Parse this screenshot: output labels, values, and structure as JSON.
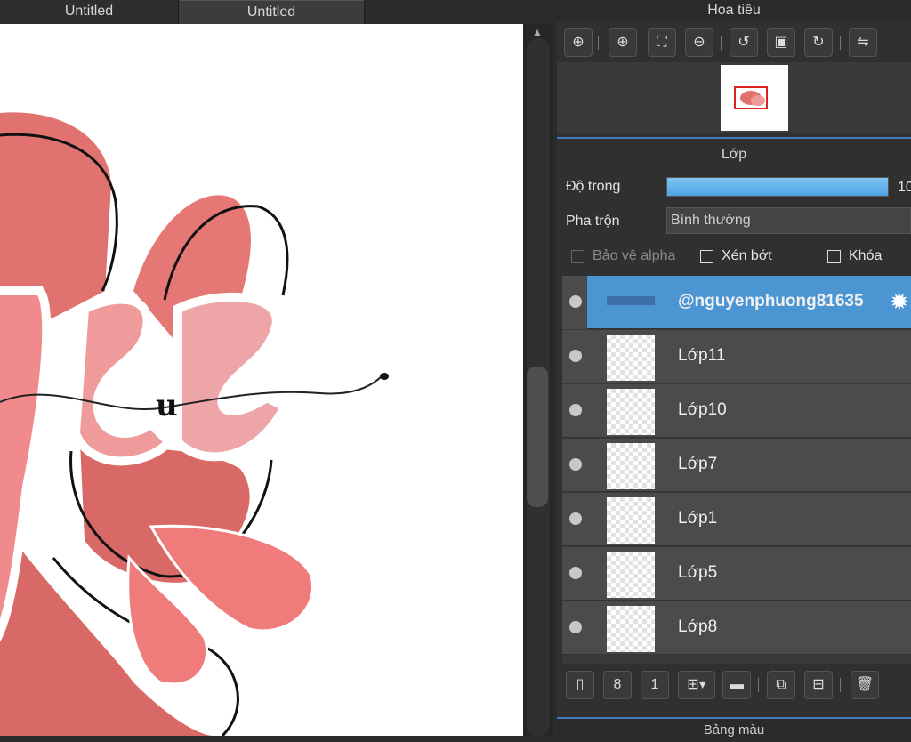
{
  "tabs": [
    "Untitled",
    "Untitled"
  ],
  "navigator": {
    "title": "Hoa tiêu",
    "tools": [
      "zoom-fit-icon",
      "zoom-in-icon",
      "fit-screen-icon",
      "zoom-out-icon",
      "rotate-left-icon",
      "reset-view-icon",
      "rotate-right-icon",
      "flip-icon"
    ]
  },
  "layer_panel": {
    "title": "Lớp",
    "opacity_label": "Độ trong",
    "opacity_value": "10",
    "blend_label": "Pha trộn",
    "blend_value": "Bình thường",
    "protect_alpha": "Bảo vệ alpha",
    "clipping": "Xén bớt",
    "lock": "Khóa",
    "layers": [
      {
        "name": "@nguyenphuong81635",
        "selected": true
      },
      {
        "name": "Lớp11",
        "selected": false
      },
      {
        "name": "Lớp10",
        "selected": false
      },
      {
        "name": "Lớp7",
        "selected": false
      },
      {
        "name": "Lớp1",
        "selected": false
      },
      {
        "name": "Lớp5",
        "selected": false
      },
      {
        "name": "Lớp8",
        "selected": false
      }
    ]
  },
  "bottom_tools": [
    "new-layer-icon",
    "new-8bit-layer-icon",
    "new-1bit-layer-icon",
    "add-layer-dropdown-icon",
    "folder-icon",
    "duplicate-layer-icon",
    "merge-layer-icon",
    "delete-layer-icon"
  ],
  "color_palette_title": "Bảng màu"
}
